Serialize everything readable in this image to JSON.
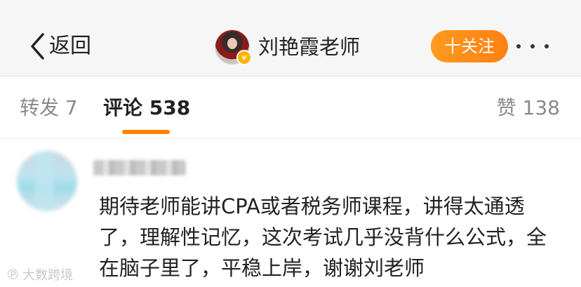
{
  "nav": {
    "back_label": "返回",
    "profile_name": "刘艳霞老师",
    "follow_label": "十关注",
    "verified_mark": "v",
    "more_icon": "more-dots-icon"
  },
  "tabs": {
    "repost": "转发 7",
    "comment": "评论 538",
    "like": "赞 138",
    "active_color": "#ff8200"
  },
  "comment": {
    "text": "期待老师能讲CPA或者税务师课程，讲得太通透了，理解性记忆，这次考试几乎没背什么公式，全在脑子里了，平稳上岸，谢谢刘老师"
  },
  "watermark": {
    "logo": "℗",
    "text": "大数跨境"
  }
}
